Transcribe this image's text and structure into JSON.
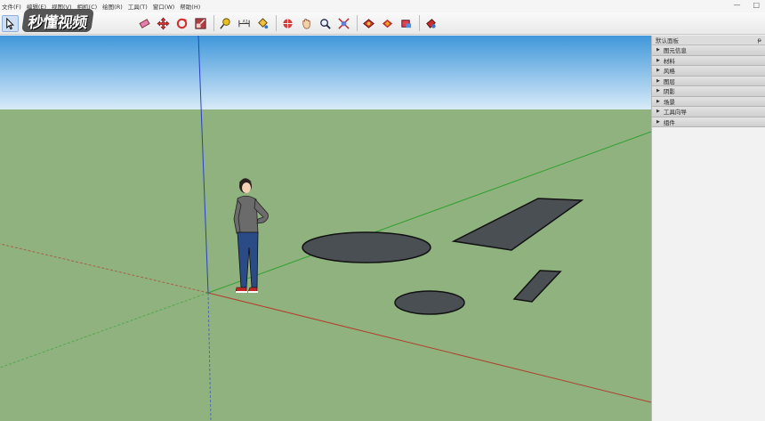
{
  "menu": [
    "文件(F)",
    "编辑(E)",
    "视图(V)",
    "相机(C)",
    "绘图(R)",
    "工具(T)",
    "窗口(W)",
    "帮助(H)"
  ],
  "window_controls": [
    "—",
    "□"
  ],
  "logo_text": "秒懂视频",
  "tray": {
    "title": "默认面板",
    "pin": "ᵽ",
    "items": [
      "图元信息",
      "材料",
      "风格",
      "图层",
      "阴影",
      "场景",
      "工具向导",
      "组件"
    ]
  },
  "colors": {
    "sky_top": "#3f97da",
    "sky_bottom": "#d8ebf8",
    "ground": "#8fb27f",
    "shape_fill": "#4a4f54",
    "axis_red": "#b04030",
    "axis_green": "#2fa02f",
    "axis_blue": "#2a40c8"
  }
}
